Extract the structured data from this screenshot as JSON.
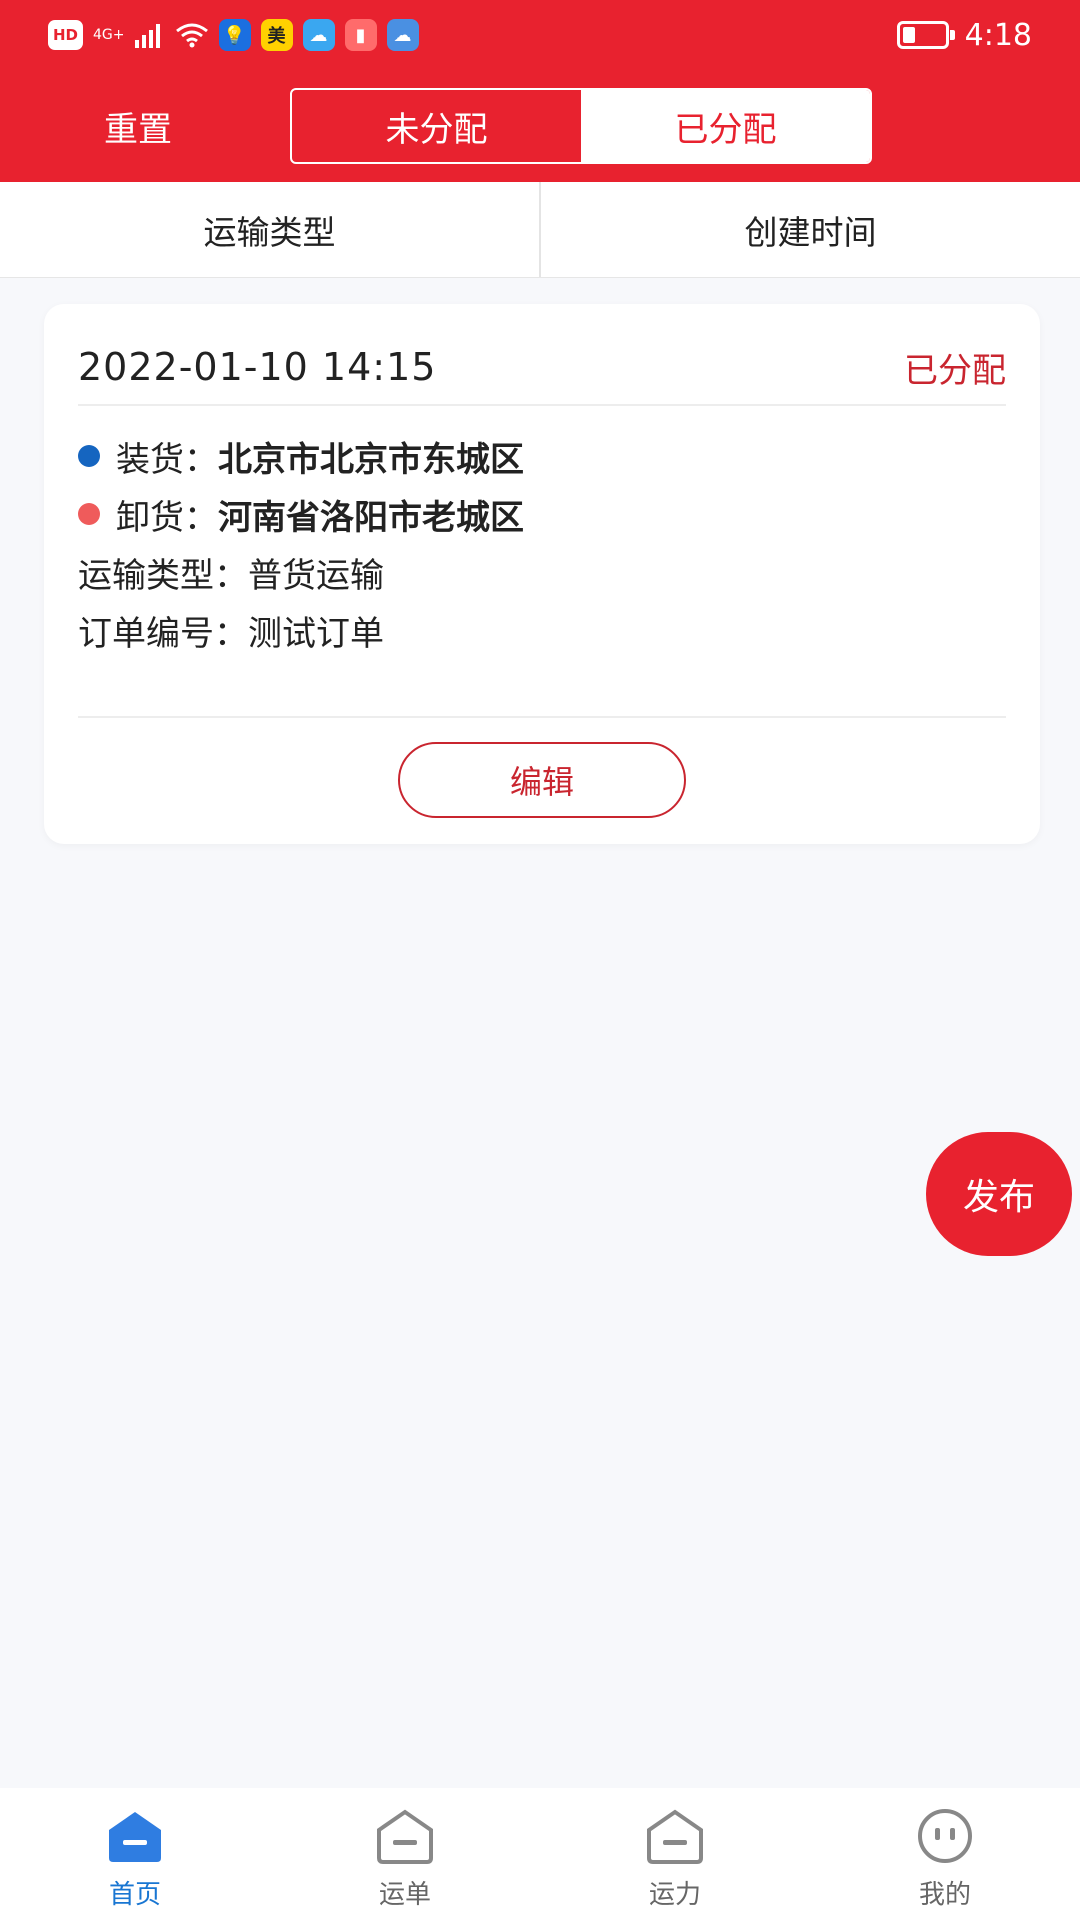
{
  "status_bar": {
    "left_badges": [
      "HD",
      "4G+"
    ],
    "app_badges": [
      {
        "name": "bulb-app-icon",
        "glyph": "💡",
        "bg": "#1b6fe0"
      },
      {
        "name": "meituan-app-icon",
        "glyph": "美",
        "bg": "#ffd100"
      },
      {
        "name": "weather-app-icon",
        "glyph": "☁",
        "bg": "#3aa7f0"
      },
      {
        "name": "book-app-icon",
        "glyph": "▮",
        "bg": "#ff6b6b"
      },
      {
        "name": "cloud-app-icon",
        "glyph": "☁",
        "bg": "#4a90e2"
      }
    ],
    "battery_level": 0.3,
    "time": "4:18"
  },
  "topbar": {
    "reset_label": "重置",
    "segments": [
      {
        "label": "未分配",
        "active": false
      },
      {
        "label": "已分配",
        "active": true
      }
    ]
  },
  "filters": {
    "transport_type": "运输类型",
    "create_time": "创建时间"
  },
  "order_card": {
    "date": "2022-01-10 14:15",
    "status": "已分配",
    "load_label": "装货：",
    "load_value": "北京市北京市东城区",
    "unload_label": "卸货：",
    "unload_value": "河南省洛阳市老城区",
    "type_label": "运输类型：",
    "type_value": "普货运输",
    "order_no_label": "订单编号：",
    "order_no_value": "测试订单",
    "edit_label": "编辑"
  },
  "fab": {
    "label": "发布"
  },
  "bottom_nav": [
    {
      "label": "首页",
      "icon": "home-icon",
      "active": true
    },
    {
      "label": "运单",
      "icon": "waybill-icon",
      "active": false
    },
    {
      "label": "运力",
      "icon": "capacity-icon",
      "active": false
    },
    {
      "label": "我的",
      "icon": "profile-icon",
      "active": false
    }
  ],
  "colors": {
    "brand_red": "#e8222f",
    "accent_blue": "#1976d2",
    "load_dot": "#1565c0",
    "unload_dot": "#ef5b5b"
  }
}
